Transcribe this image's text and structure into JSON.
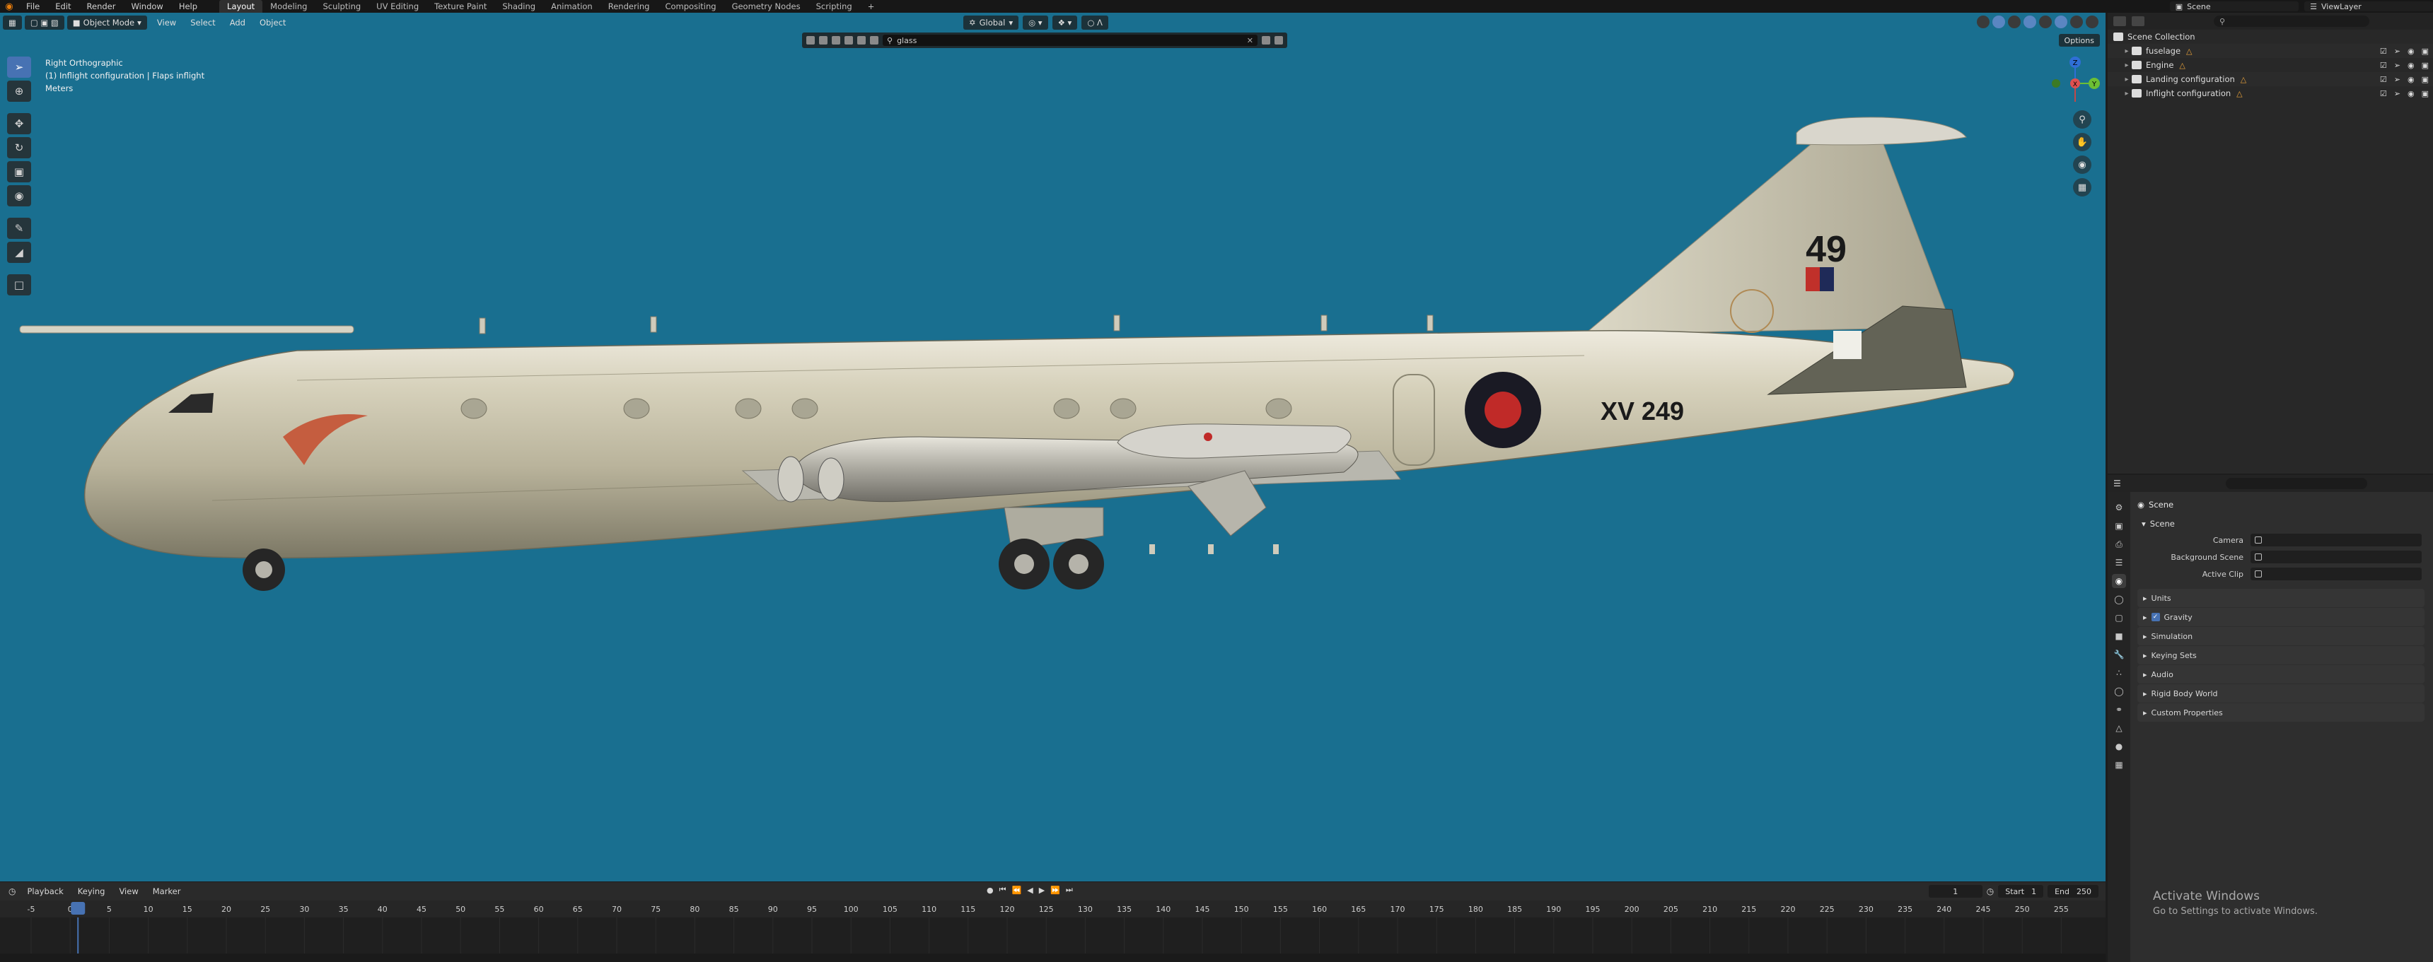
{
  "topbar": {
    "menus": [
      "File",
      "Edit",
      "Render",
      "Window",
      "Help"
    ],
    "workspaces": [
      "Layout",
      "Modeling",
      "Sculpting",
      "UV Editing",
      "Texture Paint",
      "Shading",
      "Animation",
      "Rendering",
      "Compositing",
      "Geometry Nodes",
      "Scripting"
    ],
    "active_workspace": "Layout",
    "add_tab": "+",
    "scene": "Scene",
    "view_layer": "ViewLayer"
  },
  "viewport": {
    "mode": "Object Mode",
    "menus": [
      "View",
      "Select",
      "Add",
      "Object"
    ],
    "transform_orientation": "Global",
    "search_value": "glass",
    "options_label": "Options",
    "info_line1": "Right Orthographic",
    "info_line2": "(1) Inflight configuration | Flaps inflight",
    "info_line3": "Meters",
    "gizmo_axes": [
      "Y",
      "Z",
      "X"
    ],
    "aircraft_tail_number": "49",
    "aircraft_serial": "XV 249",
    "colors": {
      "background": "#196f90",
      "fuselage": "#cfcab4",
      "roundel_outer": "#1a1a24",
      "roundel_inner": "#c02a28"
    }
  },
  "outliner": {
    "root": "Scene Collection",
    "items": [
      {
        "label": "fuselage"
      },
      {
        "label": "Engine"
      },
      {
        "label": "Landing configuration"
      },
      {
        "label": "Inflight configuration"
      }
    ]
  },
  "properties": {
    "context": "Scene",
    "panel": "Scene",
    "rows": [
      {
        "label": "Camera"
      },
      {
        "label": "Background Scene"
      },
      {
        "label": "Active Clip"
      }
    ],
    "subpanels": [
      "Units",
      "Gravity",
      "Simulation",
      "Keying Sets",
      "Audio",
      "Rigid Body World",
      "Custom Properties"
    ]
  },
  "timeline": {
    "menus": [
      "Playback",
      "Keying",
      "View",
      "Marker"
    ],
    "current_frame": "1",
    "start_label": "Start",
    "start_value": "1",
    "end_label": "End",
    "end_value": "250",
    "ticks": [
      "-5",
      "0",
      "5",
      "10",
      "15",
      "20",
      "25",
      "30",
      "35",
      "40",
      "45",
      "50",
      "55",
      "60",
      "65",
      "70",
      "75",
      "80",
      "85",
      "90",
      "95",
      "100",
      "105",
      "110",
      "115",
      "120",
      "125",
      "130",
      "135",
      "140",
      "145",
      "150",
      "155",
      "160",
      "165",
      "170",
      "175",
      "180",
      "185",
      "190",
      "195",
      "200",
      "205",
      "210",
      "215",
      "220",
      "225",
      "230",
      "235",
      "240",
      "245",
      "250",
      "255"
    ]
  },
  "activate": {
    "title": "Activate Windows",
    "subtitle": "Go to Settings to activate Windows."
  }
}
